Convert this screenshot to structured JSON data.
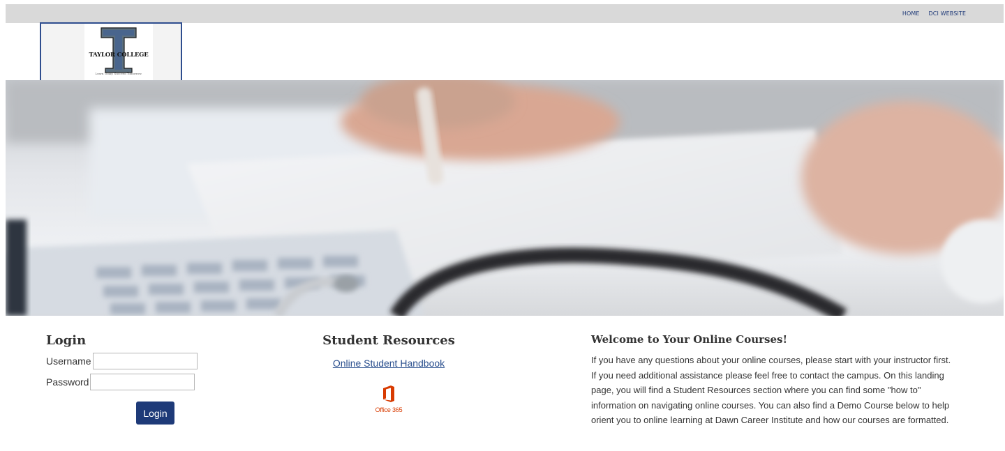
{
  "nav": {
    "home": "HOME",
    "dci_website": "DCI WEBSITE"
  },
  "logo": {
    "name": "TAYLOR COLLEGE",
    "tagline": "Learn Today. Succeed Tomorrow."
  },
  "login": {
    "title": "Login",
    "username_label": "Username",
    "username_value": "",
    "password_label": "Password",
    "password_value": "",
    "button": "Login"
  },
  "resources": {
    "title": "Student Resources",
    "handbook_link": "Online Student Handbook",
    "office_label": "Office 365",
    "office_icon": "office-365-icon"
  },
  "welcome": {
    "title": "Welcome to Your Online Courses!",
    "body": "If you have any questions about your online courses, please start with your instructor first. If you need additional assistance please feel free to contact the campus. On this landing page, you will find a Student Resources section where you can find some \"how to\" information on navigating online courses. You can also find a Demo Course below to help orient you to online learning at Dawn Career Institute and how our courses are formatted."
  },
  "colors": {
    "brand_blue": "#1e3a78",
    "link": "#2a4f8e",
    "office_orange": "#d83b01",
    "topbar": "#d9d9d9"
  }
}
